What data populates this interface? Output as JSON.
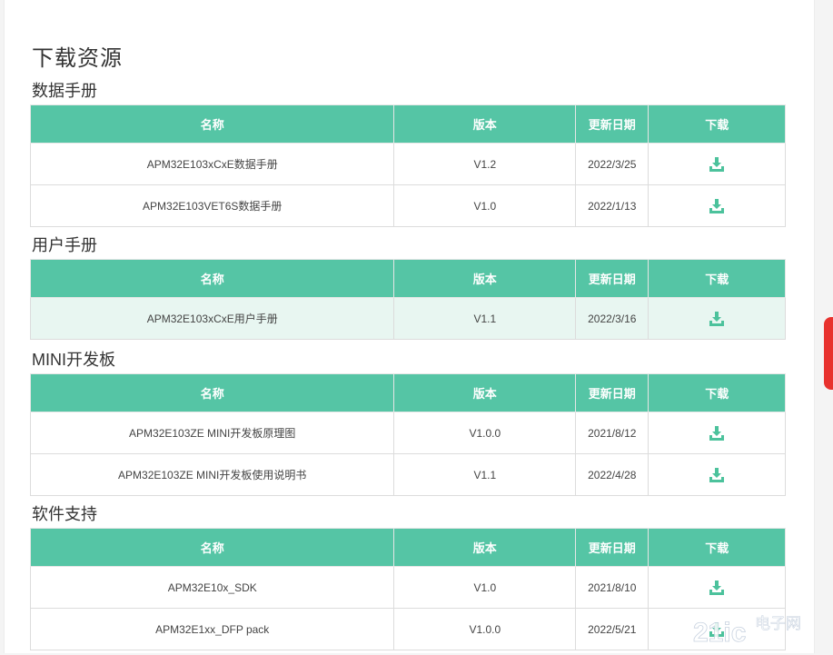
{
  "page": {
    "title": "下载资源"
  },
  "table_headers": {
    "name": "名称",
    "version": "版本",
    "date": "更新日期",
    "download": "下载"
  },
  "sections": [
    {
      "title": "数据手册",
      "rows": [
        {
          "name": "APM32E103xCxE数据手册",
          "version": "V1.2",
          "date": "2022/3/25"
        },
        {
          "name": "APM32E103VET6S数据手册",
          "version": "V1.0",
          "date": "2022/1/13"
        }
      ]
    },
    {
      "title": "用户手册",
      "rows": [
        {
          "name": "APM32E103xCxE用户手册",
          "version": "V1.1",
          "date": "2022/3/16"
        }
      ]
    },
    {
      "title": "MINI开发板",
      "rows": [
        {
          "name": "APM32E103ZE MINI开发板原理图",
          "version": "V1.0.0",
          "date": "2021/8/12"
        },
        {
          "name": "APM32E103ZE MINI开发板使用说明书",
          "version": "V1.1",
          "date": "2022/4/28"
        }
      ]
    },
    {
      "title": "软件支持",
      "rows": [
        {
          "name": "APM32E10x_SDK",
          "version": "V1.0",
          "date": "2021/8/10"
        },
        {
          "name": "APM32E1xx_DFP pack",
          "version": "V1.0.0",
          "date": "2022/5/21"
        }
      ]
    }
  ],
  "watermark": {
    "brand": "电子网",
    "logo_text": "21ic"
  },
  "colors": {
    "header_bg": "#55c5a5",
    "icon": "#4cc29c",
    "highlight_row": "#e8f6f1",
    "side_tab": "#e8322e"
  },
  "icons": {
    "download": "download-tray-icon"
  }
}
